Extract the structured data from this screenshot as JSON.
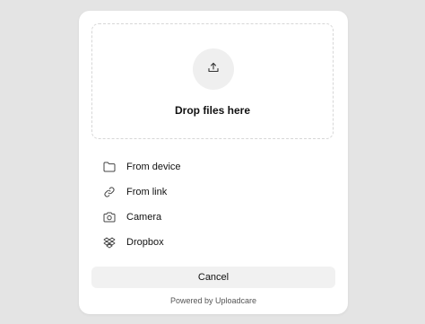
{
  "dropzone": {
    "label": "Drop files here",
    "icon": "upload-icon"
  },
  "sources": [
    {
      "label": "From device",
      "icon": "folder-icon"
    },
    {
      "label": "From link",
      "icon": "link-icon"
    },
    {
      "label": "Camera",
      "icon": "camera-icon"
    },
    {
      "label": "Dropbox",
      "icon": "dropbox-icon"
    }
  ],
  "cancel_label": "Cancel",
  "footer": {
    "powered_by": "Powered by Uploadcare"
  },
  "colors": {
    "background": "#e4e4e4",
    "surface": "#ffffff",
    "button": "#f1f1f1"
  }
}
